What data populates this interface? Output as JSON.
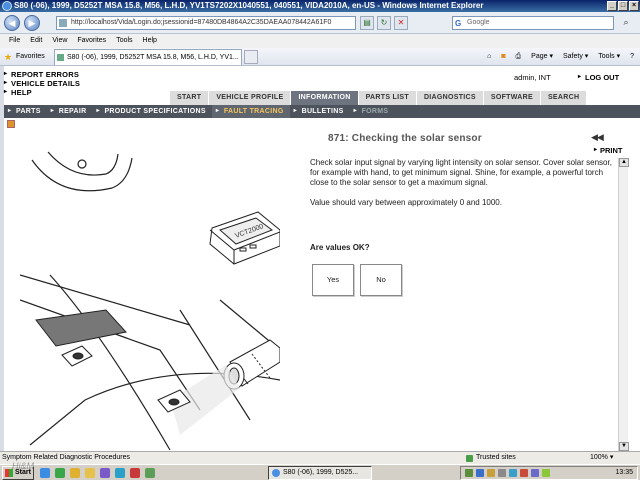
{
  "window": {
    "title": "S80 (-06), 1999, D5252T MSA 15.8, M56, L.H.D, YV1TS7202X1040551, 040551, VIDA2010A, en-US - Windows Internet Explorer",
    "controls": [
      "_",
      "□",
      "×"
    ]
  },
  "browser": {
    "address": "http://localhost/Vida/Login.do;jsessionid=87480DB4864A2C35DAEAA078442A61F0",
    "search_placeholder": "Google",
    "menu": [
      "File",
      "Edit",
      "View",
      "Favorites",
      "Tools",
      "Help"
    ],
    "favorites_label": "Favorites",
    "tab_title": "S80 (-06), 1999, D5252T MSA 15.8, M56, L.H.D, YV1...",
    "commands": [
      "Page ▾",
      "Safety ▾",
      "Tools ▾",
      "?"
    ]
  },
  "app": {
    "top_links": [
      "REPORT ERRORS",
      "VEHICLE DETAILS",
      "HELP"
    ],
    "user": "admin, INT",
    "logout": "LOG OUT",
    "main_tabs": [
      {
        "label": "START",
        "active": false
      },
      {
        "label": "VEHICLE PROFILE",
        "active": false
      },
      {
        "label": "INFORMATION",
        "active": true
      },
      {
        "label": "PARTS LIST",
        "active": false
      },
      {
        "label": "DIAGNOSTICS",
        "active": false
      },
      {
        "label": "SOFTWARE",
        "active": false
      },
      {
        "label": "SEARCH",
        "active": false
      }
    ],
    "sub_nav": [
      {
        "label": "PARTS",
        "state": "normal"
      },
      {
        "label": "REPAIR",
        "state": "normal"
      },
      {
        "label": "PRODUCT SPECIFICATIONS",
        "state": "normal"
      },
      {
        "label": "FAULT TRACING",
        "state": "active"
      },
      {
        "label": "BULLETINS",
        "state": "normal"
      },
      {
        "label": "FORMS",
        "state": "dim"
      }
    ]
  },
  "document": {
    "title": "871: Checking the solar sensor",
    "prev_next": "◀◀",
    "print_label": "PRINT",
    "paragraphs": [
      "Check solar input signal by varying light intensity on solar sensor. Cover solar sensor, for example with hand, to get minimum signal. Shine, for example, a powerful torch close to the solar sensor to get a maximum signal.",
      "Value should vary between approximately 0 and 1000."
    ],
    "question": "Are values OK?",
    "yes_label": "Yes",
    "no_label": "No",
    "device_label": "VCT2000"
  },
  "status": {
    "text": "Symptom Related Diagnostic Procedures",
    "zone": "Trusted sites",
    "zoom": "100% ▾"
  },
  "taskbar": {
    "start": "Start",
    "task": "S80 (-06), 1999, D525...",
    "clock": "13:35"
  },
  "overlay": {
    "watermark": "Hi&M"
  }
}
